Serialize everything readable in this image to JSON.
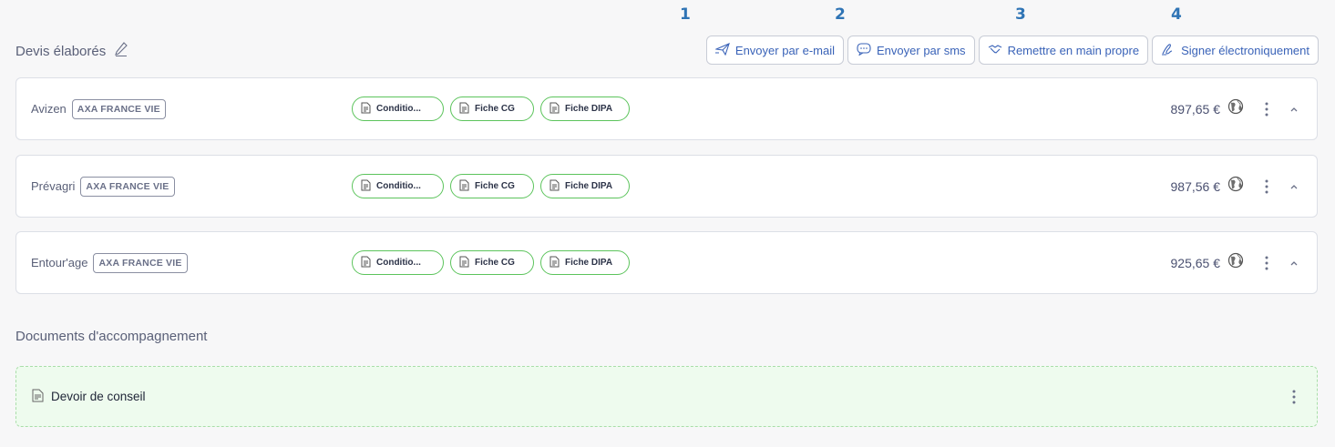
{
  "annotations": [
    "1",
    "2",
    "3",
    "4"
  ],
  "header": {
    "title": "Devis élaborés"
  },
  "toolbar": {
    "email_label": "Envoyer par e-mail",
    "sms_label": "Envoyer par sms",
    "hand_label": "Remettre en main propre",
    "sign_label": "Signer électroniquement"
  },
  "quotes": [
    {
      "name": "Avizen",
      "insurer": "AXA FRANCE VIE",
      "price": "897,65 €",
      "documents": [
        "Conditio...",
        "Fiche CG",
        "Fiche DIPA"
      ]
    },
    {
      "name": "Prévagri",
      "insurer": "AXA FRANCE VIE",
      "price": "987,56 €",
      "documents": [
        "Conditio...",
        "Fiche CG",
        "Fiche DIPA"
      ]
    },
    {
      "name": "Entour'age",
      "insurer": "AXA FRANCE VIE",
      "price": "925,65 €",
      "documents": [
        "Conditio...",
        "Fiche CG",
        "Fiche DIPA"
      ]
    }
  ],
  "accompanying": {
    "title": "Documents d'accompagnement",
    "documents": [
      {
        "name": "Devoir de conseil"
      }
    ]
  },
  "colors": {
    "accent_blue": "#3a63b8",
    "annotation_blue": "#2f74b5",
    "pill_green": "#5cc45c",
    "doc_bg_green": "#eefbee"
  },
  "icons": [
    "pencil-icon",
    "send-icon",
    "sms-icon",
    "handshake-icon",
    "signature-icon",
    "document-icon",
    "globe-icon",
    "kebab-icon",
    "chevron-up-icon"
  ]
}
